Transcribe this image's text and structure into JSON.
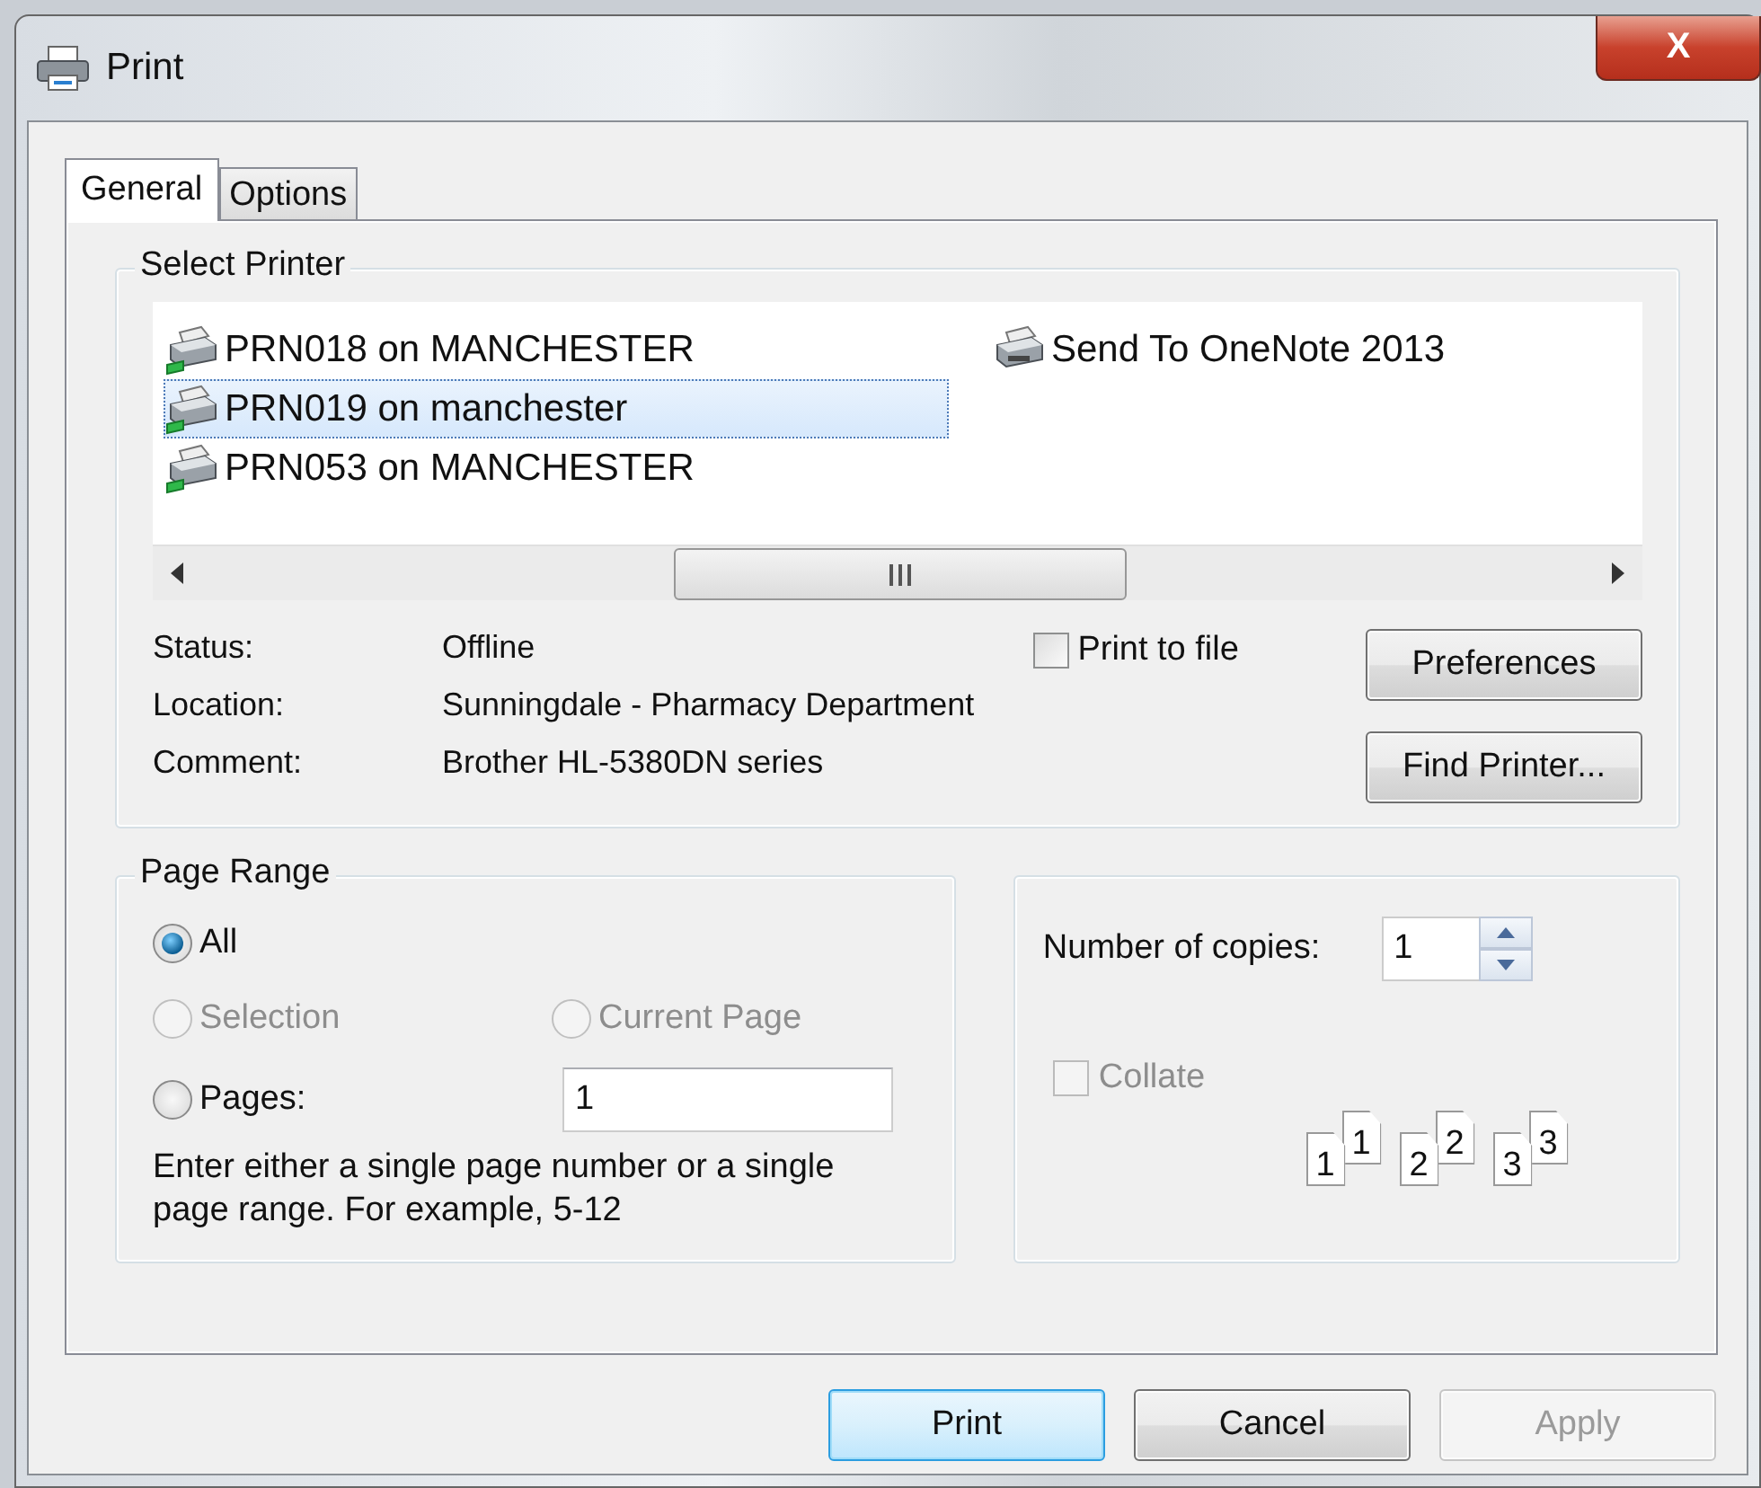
{
  "window": {
    "title": "Print",
    "close": "X"
  },
  "tabs": [
    {
      "label": "General",
      "selected": true
    },
    {
      "label": "Options",
      "selected": false
    }
  ],
  "select_printer": {
    "title": "Select Printer",
    "printers": [
      {
        "name": "PRN018 on MANCHESTER",
        "kind": "network",
        "selected": false
      },
      {
        "name": "PRN019 on manchester",
        "kind": "network",
        "selected": true
      },
      {
        "name": "PRN053 on MANCHESTER",
        "kind": "network",
        "selected": false
      },
      {
        "name": "Send To OneNote 2013",
        "kind": "local",
        "selected": false
      }
    ],
    "details": [
      {
        "label": "Status:",
        "value": "Offline"
      },
      {
        "label": "Location:",
        "value": "Sunningdale - Pharmacy Department"
      },
      {
        "label": "Comment:",
        "value": "Brother HL-5380DN series"
      }
    ],
    "print_to_file": {
      "label": "Print to file",
      "checked": false
    },
    "buttons": [
      "Preferences",
      "Find Printer..."
    ]
  },
  "page_range": {
    "title": "Page Range",
    "radios": [
      {
        "label": "All",
        "selected": true,
        "disabled": false
      },
      {
        "label": "Selection",
        "selected": false,
        "disabled": true
      },
      {
        "label": "Current Page",
        "selected": false,
        "disabled": true
      },
      {
        "label": "Pages:",
        "selected": false,
        "disabled": false
      }
    ],
    "pages_value": "1",
    "hint": "Enter either a single page number or a single page range.  For example, 5-12"
  },
  "copies": {
    "label": "Number of copies:",
    "value": "1",
    "collate": {
      "label": "Collate",
      "checked": false,
      "disabled": true
    },
    "collate_pages": [
      {
        "back": "1",
        "front": "1"
      },
      {
        "back": "2",
        "front": "2"
      },
      {
        "back": "3",
        "front": "3"
      }
    ]
  },
  "buttons": [
    {
      "label": "Print",
      "default": true,
      "disabled": false
    },
    {
      "label": "Cancel",
      "default": false,
      "disabled": false
    },
    {
      "label": "Apply",
      "default": false,
      "disabled": true
    }
  ]
}
